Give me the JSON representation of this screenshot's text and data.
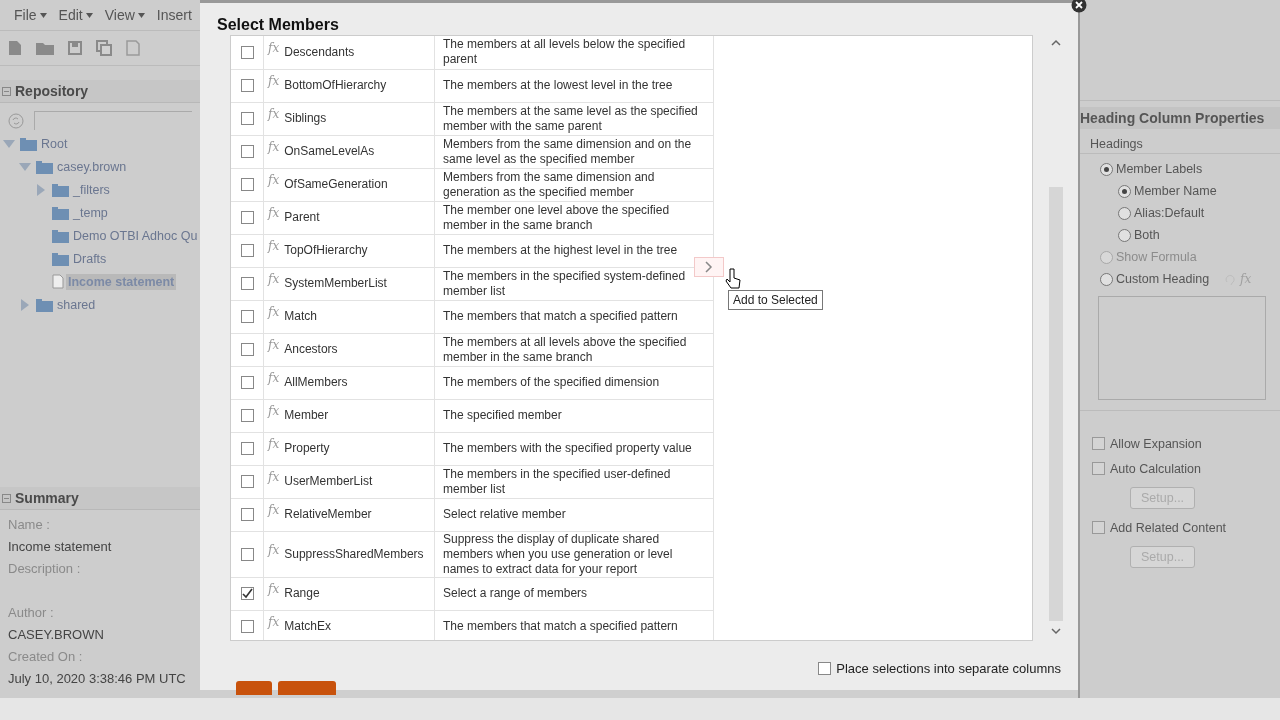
{
  "menu": [
    {
      "label": "File",
      "dropdown": true
    },
    {
      "label": "Edit",
      "dropdown": true
    },
    {
      "label": "View",
      "dropdown": true
    },
    {
      "label": "Insert",
      "dropdown": false
    }
  ],
  "repository": {
    "title": "Repository",
    "tree": [
      {
        "label": "Root",
        "kind": "folder",
        "expanded": true,
        "selected": false,
        "children": [
          {
            "label": "casey.brown",
            "kind": "folder",
            "expanded": true,
            "selected": false,
            "children": [
              {
                "label": "_filters",
                "kind": "folder",
                "expanded": false,
                "selected": false
              },
              {
                "label": "_temp",
                "kind": "folder",
                "selected": false
              },
              {
                "label": "Demo OTBI Adhoc Qu",
                "kind": "folder",
                "selected": false
              },
              {
                "label": "Drafts",
                "kind": "folder",
                "selected": false
              },
              {
                "label": "Income statement",
                "kind": "file",
                "selected": true
              }
            ]
          },
          {
            "label": "shared",
            "kind": "folder",
            "expanded": false,
            "selected": false
          }
        ]
      }
    ]
  },
  "summary": {
    "title": "Summary",
    "fields": [
      {
        "label": "Name :",
        "value": "Income statement"
      },
      {
        "label": "Description :"
      },
      {
        "label": "Author :",
        "value": "CASEY.BROWN"
      },
      {
        "label": "Created On :",
        "value": "July 10, 2020 3:38:46 PM UTC"
      }
    ]
  },
  "dialog": {
    "title": "Select Members",
    "rows": [
      {
        "icon": "fx",
        "name": "Descendants",
        "description": "The members at all levels below the specified parent",
        "checked": false
      },
      {
        "icon": "fx",
        "name": "BottomOfHierarchy",
        "description": "The members at the lowest level in the tree",
        "checked": false
      },
      {
        "icon": "fx",
        "name": "Siblings",
        "description": "The members at the same level as the specified member with the same parent",
        "checked": false
      },
      {
        "icon": "fx",
        "name": "OnSameLevelAs",
        "description": "Members from the same dimension and on the same level as the specified member",
        "checked": false
      },
      {
        "icon": "fx",
        "name": "OfSameGeneration",
        "description": "Members from the same dimension and generation as the specified member",
        "checked": false
      },
      {
        "icon": "fx",
        "name": "Parent",
        "description": "The member one level above the specified member in the same branch",
        "checked": false
      },
      {
        "icon": "fx",
        "name": "TopOfHierarchy",
        "description": "The members at the highest level in the tree",
        "checked": false
      },
      {
        "icon": "fx",
        "name": "SystemMemberList",
        "description": "The members in the specified system-defined member list",
        "checked": false
      },
      {
        "icon": "fx",
        "name": "Match",
        "description": "The members that match a specified pattern",
        "checked": false
      },
      {
        "icon": "fx",
        "name": "Ancestors",
        "description": "The members at all levels above the specified member in the same branch",
        "checked": false
      },
      {
        "icon": "fx",
        "name": "AllMembers",
        "description": "The members of the specified dimension",
        "checked": false
      },
      {
        "icon": "fx",
        "name": "Member",
        "description": "The specified member",
        "checked": false
      },
      {
        "icon": "fx",
        "name": "Property",
        "description": "The members with the specified property value",
        "checked": false
      },
      {
        "icon": "fx",
        "name": "UserMemberList",
        "description": "The members in the specified user-defined member list",
        "checked": false
      },
      {
        "icon": "fx",
        "name": "RelativeMember",
        "description": "Select relative member",
        "checked": false
      },
      {
        "icon": "fx",
        "name": "SuppressSharedMembers",
        "description": "Suppress the display of duplicate shared members when you use generation or level names to extract data for your report",
        "checked": false
      },
      {
        "icon": "fx",
        "name": "Range",
        "description": "Select a range of members",
        "checked": true
      },
      {
        "icon": "fx",
        "name": "MatchEx",
        "description": "The members that match a specified pattern",
        "checked": false
      }
    ],
    "tooltip": "Add to Selected",
    "option": {
      "label": "Place selections into separate columns",
      "checked": false
    }
  },
  "properties": {
    "title": "Heading Column Properties",
    "group": "Headings",
    "radios": [
      {
        "label": "Member Labels",
        "selected": true,
        "disabled": false,
        "children": [
          {
            "label": "Member Name",
            "selected": true,
            "disabled": false
          },
          {
            "label": "Alias:Default",
            "selected": false,
            "disabled": false
          },
          {
            "label": "Both",
            "selected": false,
            "disabled": false
          }
        ]
      },
      {
        "label": "Show Formula",
        "selected": false,
        "disabled": true
      },
      {
        "label": "Custom Heading",
        "selected": false,
        "disabled": false
      }
    ],
    "formula_icon": "fx",
    "items": [
      {
        "kind": "checkbox",
        "label": "Allow Expansion",
        "checked": false
      },
      {
        "kind": "checkbox",
        "label": "Auto Calculation",
        "checked": false
      },
      {
        "kind": "button",
        "label": "Setup...",
        "disabled": true
      },
      {
        "kind": "checkbox",
        "label": "Add Related Content",
        "checked": false
      },
      {
        "kind": "button",
        "label": "Setup...",
        "disabled": true
      }
    ]
  }
}
